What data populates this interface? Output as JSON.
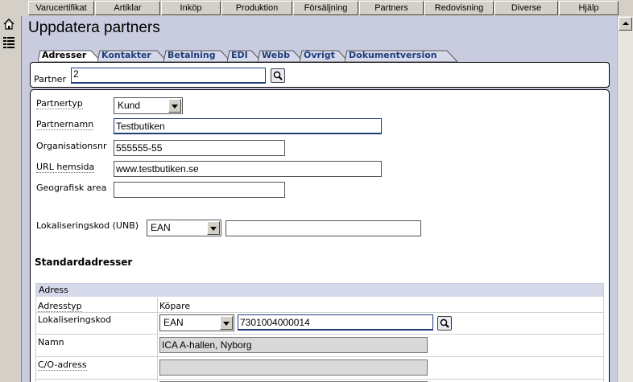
{
  "menu": [
    "Varucertifikat",
    "Artiklar",
    "Inköp",
    "Produktion",
    "Försäljning",
    "Partners",
    "Redovisning",
    "Diverse",
    "Hjälp"
  ],
  "page": {
    "title": "Uppdatera partners"
  },
  "tabs": [
    "Adresser",
    "Kontakter",
    "Betalning",
    "EDI",
    "Webb",
    "Övrigt",
    "Dokumentversion"
  ],
  "active_tab": "Adresser",
  "partner": {
    "label": "Partner",
    "value": "2"
  },
  "form": {
    "partnertyp_label": "Partnertyp",
    "partnertyp_value": "Kund",
    "partnernamn_label": "Partnernamn",
    "partnernamn_value": "Testbutiken",
    "orgnr_label": "Organisationsnr",
    "orgnr_value": "555555-55",
    "url_label": "URL hemsida",
    "url_value": "www.testbutiken.se",
    "geo_label": "Geografisk area",
    "geo_value": "",
    "lok_label": "Lokaliseringskod (UNB)",
    "lok_type": "EAN",
    "lok_value": ""
  },
  "standard": {
    "heading": "Standardadresser",
    "table_header": "Adress",
    "adresstyp_label": "Adresstyp",
    "adresstyp_value": "Köpare",
    "lok_label": "Lokaliseringskod",
    "lok_type": "EAN",
    "lok_value": "7301004000014",
    "namn_label": "Namn",
    "namn_value": "ICA A-hallen, Nyborg",
    "co_label": "C/O-adress",
    "co_value": ""
  }
}
